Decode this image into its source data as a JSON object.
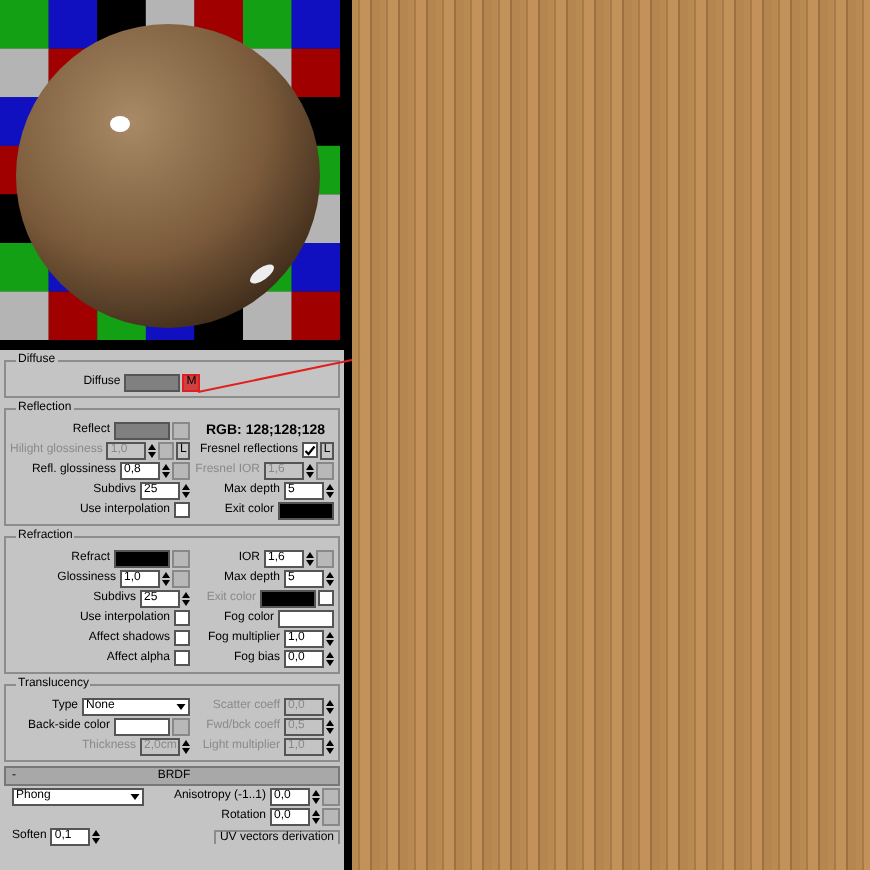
{
  "groups": [
    {
      "kind": "group",
      "title": "Diffuse",
      "rows": [
        {
          "center": {
            "kind": "swatch",
            "label": "Diffuse",
            "color": "#808080",
            "disabled": false,
            "map_label": "M"
          }
        }
      ]
    },
    {
      "kind": "group",
      "title": "Reflection",
      "rows": [
        {
          "left": {
            "kind": "swatch",
            "label": "Reflect",
            "color": "#808080",
            "disabled": false,
            "map_button": true
          },
          "right": {
            "kind": "text",
            "text": "RGB: 128;128;128"
          }
        },
        {
          "left": {
            "kind": "spinner",
            "label": "Hilight glossiness",
            "value": "1,0",
            "disabled": true,
            "map_button": true,
            "lock": "L"
          },
          "right": {
            "kind": "checkbox",
            "label": "Fresnel reflections",
            "checked": true,
            "lock": "L"
          }
        },
        {
          "left": {
            "kind": "spinner",
            "label": "Refl. glossiness",
            "value": "0,8",
            "disabled": false,
            "map_button": true
          },
          "right": {
            "kind": "spinner",
            "label": "Fresnel IOR",
            "value": "1,6",
            "disabled": true,
            "map_button": true
          }
        },
        {
          "left": {
            "kind": "spinner",
            "label": "Subdivs",
            "value": "25",
            "disabled": false
          },
          "right": {
            "kind": "spinner",
            "label": "Max depth",
            "value": "5",
            "disabled": false
          }
        },
        {
          "left": {
            "kind": "checkbox",
            "label": "Use interpolation",
            "checked": false
          },
          "right": {
            "kind": "swatch",
            "label": "Exit color",
            "color": "#000000",
            "disabled": false
          }
        }
      ]
    },
    {
      "kind": "group",
      "title": "Refraction",
      "rows": [
        {
          "left": {
            "kind": "swatch",
            "label": "Refract",
            "color": "#000000",
            "disabled": false,
            "map_button": true
          },
          "right": {
            "kind": "spinner",
            "label": "IOR",
            "value": "1,6",
            "disabled": false,
            "map_button": true
          }
        },
        {
          "left": {
            "kind": "spinner",
            "label": "Glossiness",
            "value": "1,0",
            "disabled": false,
            "map_button": true
          },
          "right": {
            "kind": "spinner",
            "label": "Max depth",
            "value": "5",
            "disabled": false
          }
        },
        {
          "left": {
            "kind": "spinner",
            "label": "Subdivs",
            "value": "25",
            "disabled": false
          },
          "right": {
            "kind": "swatch",
            "label": "Exit color",
            "color": "#000000",
            "disabled": true,
            "checked": false
          }
        },
        {
          "left": {
            "kind": "checkbox",
            "label": "Use interpolation",
            "checked": false
          },
          "right": {
            "kind": "swatch",
            "label": "Fog color",
            "color": "#ffffff",
            "disabled": false
          }
        },
        {
          "left": {
            "kind": "checkbox",
            "label": "Affect shadows",
            "checked": false
          },
          "right": {
            "kind": "spinner",
            "label": "Fog multiplier",
            "value": "1,0",
            "disabled": false
          }
        },
        {
          "left": {
            "kind": "checkbox",
            "label": "Affect alpha",
            "checked": false
          },
          "right": {
            "kind": "spinner",
            "label": "Fog bias",
            "value": "0,0",
            "disabled": false
          }
        }
      ]
    },
    {
      "kind": "group",
      "title": "Translucency",
      "rows": [
        {
          "left": {
            "kind": "dropdown",
            "label": "Type",
            "value": "None"
          },
          "right": {
            "kind": "spinner",
            "label": "Scatter coeff",
            "value": "0,0",
            "disabled": true
          }
        },
        {
          "left": {
            "kind": "swatch",
            "label": "Back-side color",
            "color": "#ffffff",
            "disabled": false,
            "map_button": true
          },
          "right": {
            "kind": "spinner",
            "label": "Fwd/bck coeff",
            "value": "0,5",
            "disabled": true
          }
        },
        {
          "left": {
            "kind": "spinner",
            "label": "Thickness",
            "value": "2,0cm",
            "disabled": true
          },
          "right": {
            "kind": "spinner",
            "label": "Light multiplier",
            "value": "1,0",
            "disabled": true
          }
        }
      ]
    },
    {
      "kind": "rollout",
      "toggle": "-",
      "title": "BRDF",
      "rows": [
        {
          "left": {
            "kind": "dropdown",
            "value": "Phong"
          },
          "right": {
            "kind": "spinner",
            "label": "Anisotropy (-1..1)",
            "value": "0,0",
            "disabled": false,
            "map_button": true
          }
        },
        {
          "right": {
            "kind": "spinner",
            "label": "Rotation",
            "value": "0,0",
            "disabled": false,
            "map_button": true
          }
        },
        {
          "left": {
            "kind": "spinner",
            "label": "Soften",
            "value": "0,1",
            "disabled": false
          },
          "right": {
            "kind": "legend",
            "text": "UV vectors derivation"
          }
        }
      ]
    }
  ]
}
